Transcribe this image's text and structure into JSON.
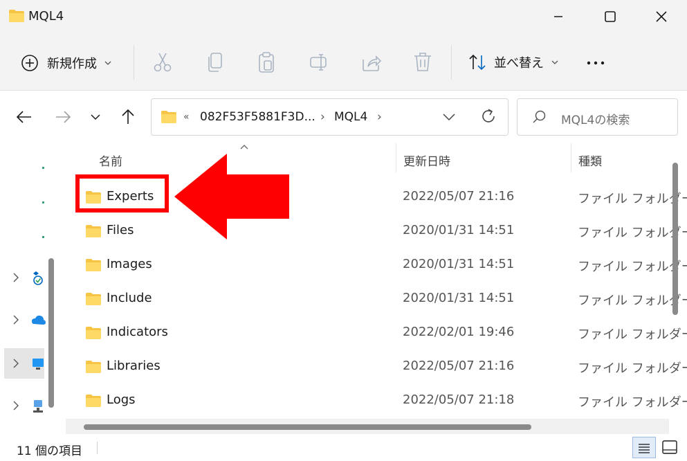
{
  "window": {
    "title": "MQL4",
    "folder_icon": "folder-icon",
    "controls": [
      "minimize-icon",
      "maximize-icon",
      "close-icon"
    ]
  },
  "toolbar": {
    "new_label": "新規作成",
    "sort_label": "並べ替え",
    "actions": [
      "cut-icon",
      "copy-icon",
      "paste-icon",
      "rename-icon",
      "share-icon",
      "delete-icon"
    ]
  },
  "address": {
    "overflow": "«",
    "crumbs": [
      "082F53F5881F3D...",
      "MQL4"
    ],
    "separator": "›"
  },
  "search": {
    "placeholder": "MQL4の検索"
  },
  "columns": {
    "name": "名前",
    "date": "更新日時",
    "type": "種類"
  },
  "files": [
    {
      "name": "Experts",
      "date": "2022/05/07 21:16",
      "type": "ファイル フォルダー"
    },
    {
      "name": "Files",
      "date": "2020/01/31 14:51",
      "type": "ファイル フォルダー"
    },
    {
      "name": "Images",
      "date": "2020/01/31 14:51",
      "type": "ファイル フォルダー"
    },
    {
      "name": "Include",
      "date": "2020/01/31 14:51",
      "type": "ファイル フォルダー"
    },
    {
      "name": "Indicators",
      "date": "2022/02/01 19:46",
      "type": "ファイル フォルダー"
    },
    {
      "name": "Libraries",
      "date": "2022/05/07 21:16",
      "type": "ファイル フォルダー"
    },
    {
      "name": "Logs",
      "date": "2022/05/07 21:18",
      "type": "ファイル フォルダー"
    }
  ],
  "status": {
    "count_text": "11 個の項目"
  },
  "colors": {
    "accent": "#0067c0",
    "highlight": "#ff0000",
    "folder": "#f7c545",
    "chrome_bg": "#f3f3f3"
  }
}
